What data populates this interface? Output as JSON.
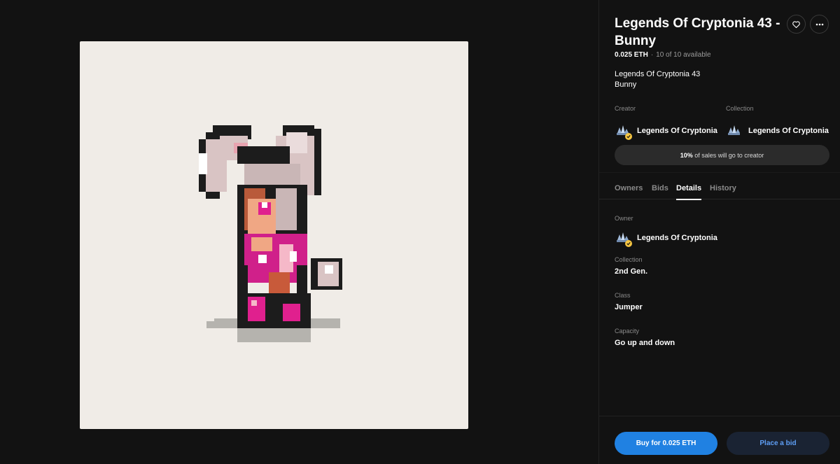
{
  "nft": {
    "title": "Legends Of Cryptonia 43 - Bunny",
    "price": "0.025 ETH",
    "separator": "·",
    "availability": "10 of 10 available",
    "description_lines": [
      "Legends Of Cryptonia 43",
      "Bunny"
    ]
  },
  "creator": {
    "label": "Creator",
    "name": "Legends Of Cryptonia",
    "verified": true
  },
  "collection": {
    "label": "Collection",
    "name": "Legends Of Cryptonia"
  },
  "royalty": {
    "percent": "10%",
    "text": " of sales will go to creator"
  },
  "tabs": [
    {
      "label": "Owners",
      "active": false
    },
    {
      "label": "Bids",
      "active": false
    },
    {
      "label": "Details",
      "active": true
    },
    {
      "label": "History",
      "active": false
    }
  ],
  "details": {
    "owner": {
      "label": "Owner",
      "name": "Legends Of Cryptonia",
      "verified": true
    },
    "properties": [
      {
        "label": "Collection",
        "value": "2nd Gen."
      },
      {
        "label": "Class",
        "value": "Jumper"
      },
      {
        "label": "Capacity",
        "value": "Go up and down"
      }
    ]
  },
  "actions": {
    "buy_label": "Buy for 0.025 ETH",
    "bid_label": "Place a bid"
  },
  "icons": {
    "favorite": "heart-icon",
    "more": "more-icon",
    "avatar": "crystal-icon",
    "badge": "verified-badge-icon"
  },
  "colors": {
    "background": "#121212",
    "primary": "#2081e2",
    "verified": "#f5c542",
    "artwork_bg": "#f0ece7"
  }
}
